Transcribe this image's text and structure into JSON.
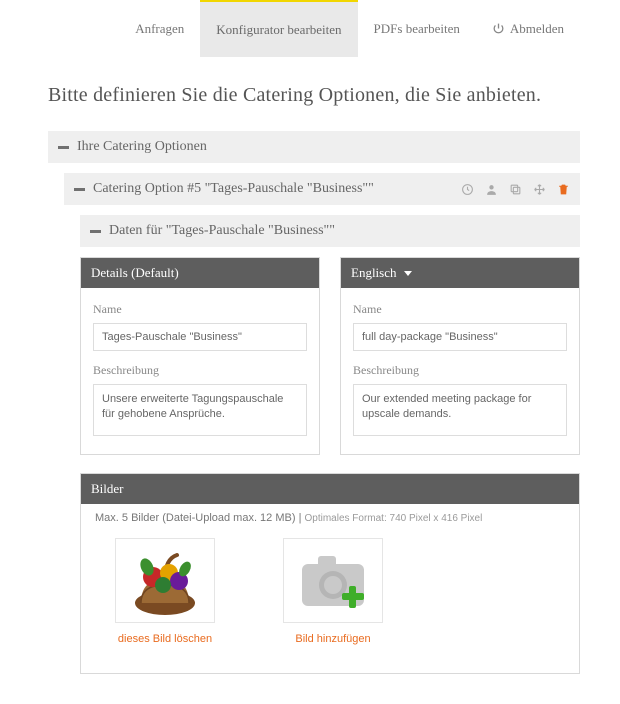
{
  "nav": {
    "items": [
      {
        "label": "Anfragen"
      },
      {
        "label": "Konfigurator bearbeiten"
      },
      {
        "label": "PDFs bearbeiten"
      },
      {
        "label": "Abmelden"
      }
    ]
  },
  "page_title": "Bitte definieren Sie die Catering Optionen, die Sie anbieten.",
  "acc": {
    "level1": "Ihre Catering Optionen",
    "level2": "Catering Option #5 \"Tages-Pauschale \"Business\"\"",
    "level3": "Daten für \"Tages-Pauschale \"Business\"\""
  },
  "panels": {
    "default": {
      "title": "Details (Default)",
      "name_label": "Name",
      "name_value": "Tages-Pauschale \"Business\"",
      "desc_label": "Beschreibung",
      "desc_value": "Unsere erweiterte Tagungspauschale für gehobene Ansprüche."
    },
    "english": {
      "title": "Englisch",
      "name_label": "Name",
      "name_value": "full day-package \"Business\"",
      "desc_label": "Beschreibung",
      "desc_value": "Our extended meeting package for upscale demands."
    }
  },
  "bilder": {
    "title": "Bilder",
    "hint_main": "Max. 5 Bilder (Datei-Upload max. 12 MB) | ",
    "hint_small": "Optimales Format: 740 Pixel x 416 Pixel",
    "thumb_delete": "dieses Bild löschen",
    "thumb_add": "Bild hinzufügen"
  }
}
